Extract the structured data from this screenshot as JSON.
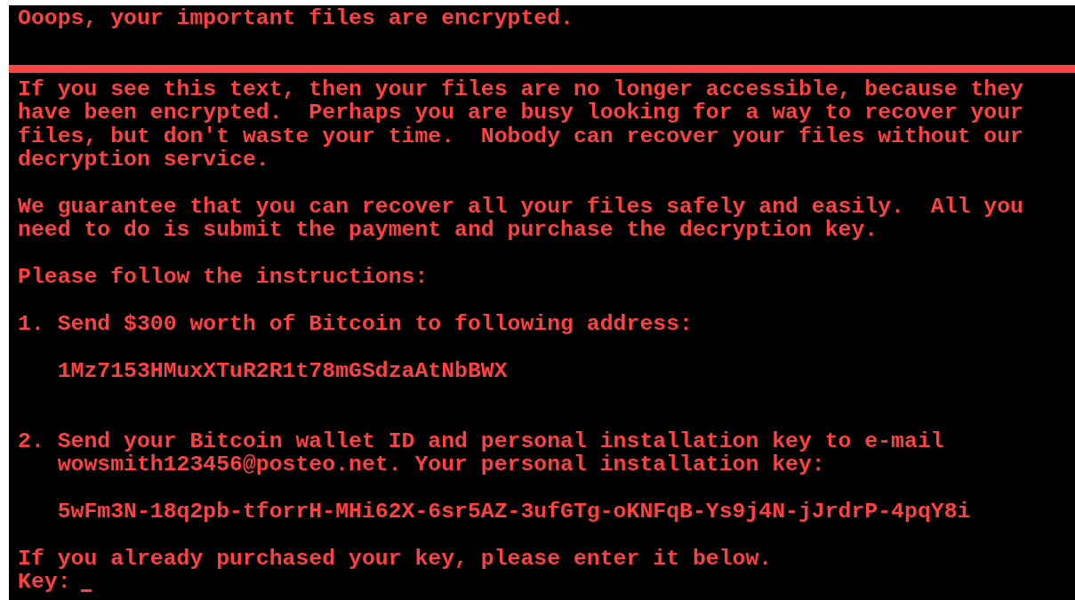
{
  "screen": {
    "title": "Ooops, your important files are encrypted.",
    "blocks": [
      {
        "kind": "paragraph",
        "text": "If you see this text, then your files are no longer accessible, because they have been encrypted.  Perhaps you are busy looking for a way to recover your files, but don't waste your time.  Nobody can recover your files without our decryption service."
      },
      {
        "kind": "paragraph",
        "text": "We guarantee that you can recover all your files safely and easily.  All you need to do is submit the payment and purchase the decryption key."
      },
      {
        "kind": "paragraph",
        "text": "Please follow the instructions:"
      },
      {
        "kind": "step",
        "number": "1.",
        "text": "Send $300 worth of Bitcoin to following address:"
      },
      {
        "kind": "code",
        "text": "1Mz7153HMuxXTuR2R1t78mGSdzaAtNbBWX"
      },
      {
        "kind": "step",
        "number": "2.",
        "text": "Send your Bitcoin wallet ID and personal installation key to e-mail wowsmith123456@posteo.net. Your personal installation key:"
      },
      {
        "kind": "code",
        "text": "5wFm3N-18q2pb-tforrH-MHi62X-6sr5AZ-3ufGTg-oKNFqB-Ys9j4N-jJrdrP-4pqY8i"
      },
      {
        "kind": "paragraph",
        "text": "If you already purchased your key, please enter it below."
      }
    ],
    "key_prompt": {
      "label": "Key:"
    }
  }
}
